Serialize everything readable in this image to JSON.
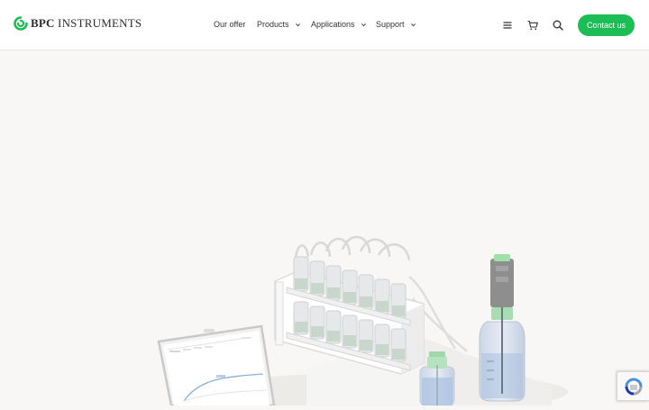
{
  "brand": {
    "name_bold": "BPC",
    "name_rest": " INSTRUMENTS",
    "logo_icon": "bpc-swirl-logo",
    "accent_color": "#1bbd55"
  },
  "nav": {
    "items": [
      {
        "label": "Our offer",
        "has_dropdown": false
      },
      {
        "label": "Products",
        "has_dropdown": true
      },
      {
        "label": "Applications",
        "has_dropdown": true
      },
      {
        "label": "Support",
        "has_dropdown": true
      }
    ]
  },
  "toolbar": {
    "menu_icon": "hamburger-menu-icon",
    "cart_icon": "shopping-cart-icon",
    "search_icon": "search-icon",
    "contact_label": "Contact us"
  },
  "hero": {
    "illustration": "laboratory instruments: laptop with chart, bottle-rack analyzer, sensor bottle"
  },
  "recaptcha": {
    "icon": "recaptcha-icon"
  }
}
